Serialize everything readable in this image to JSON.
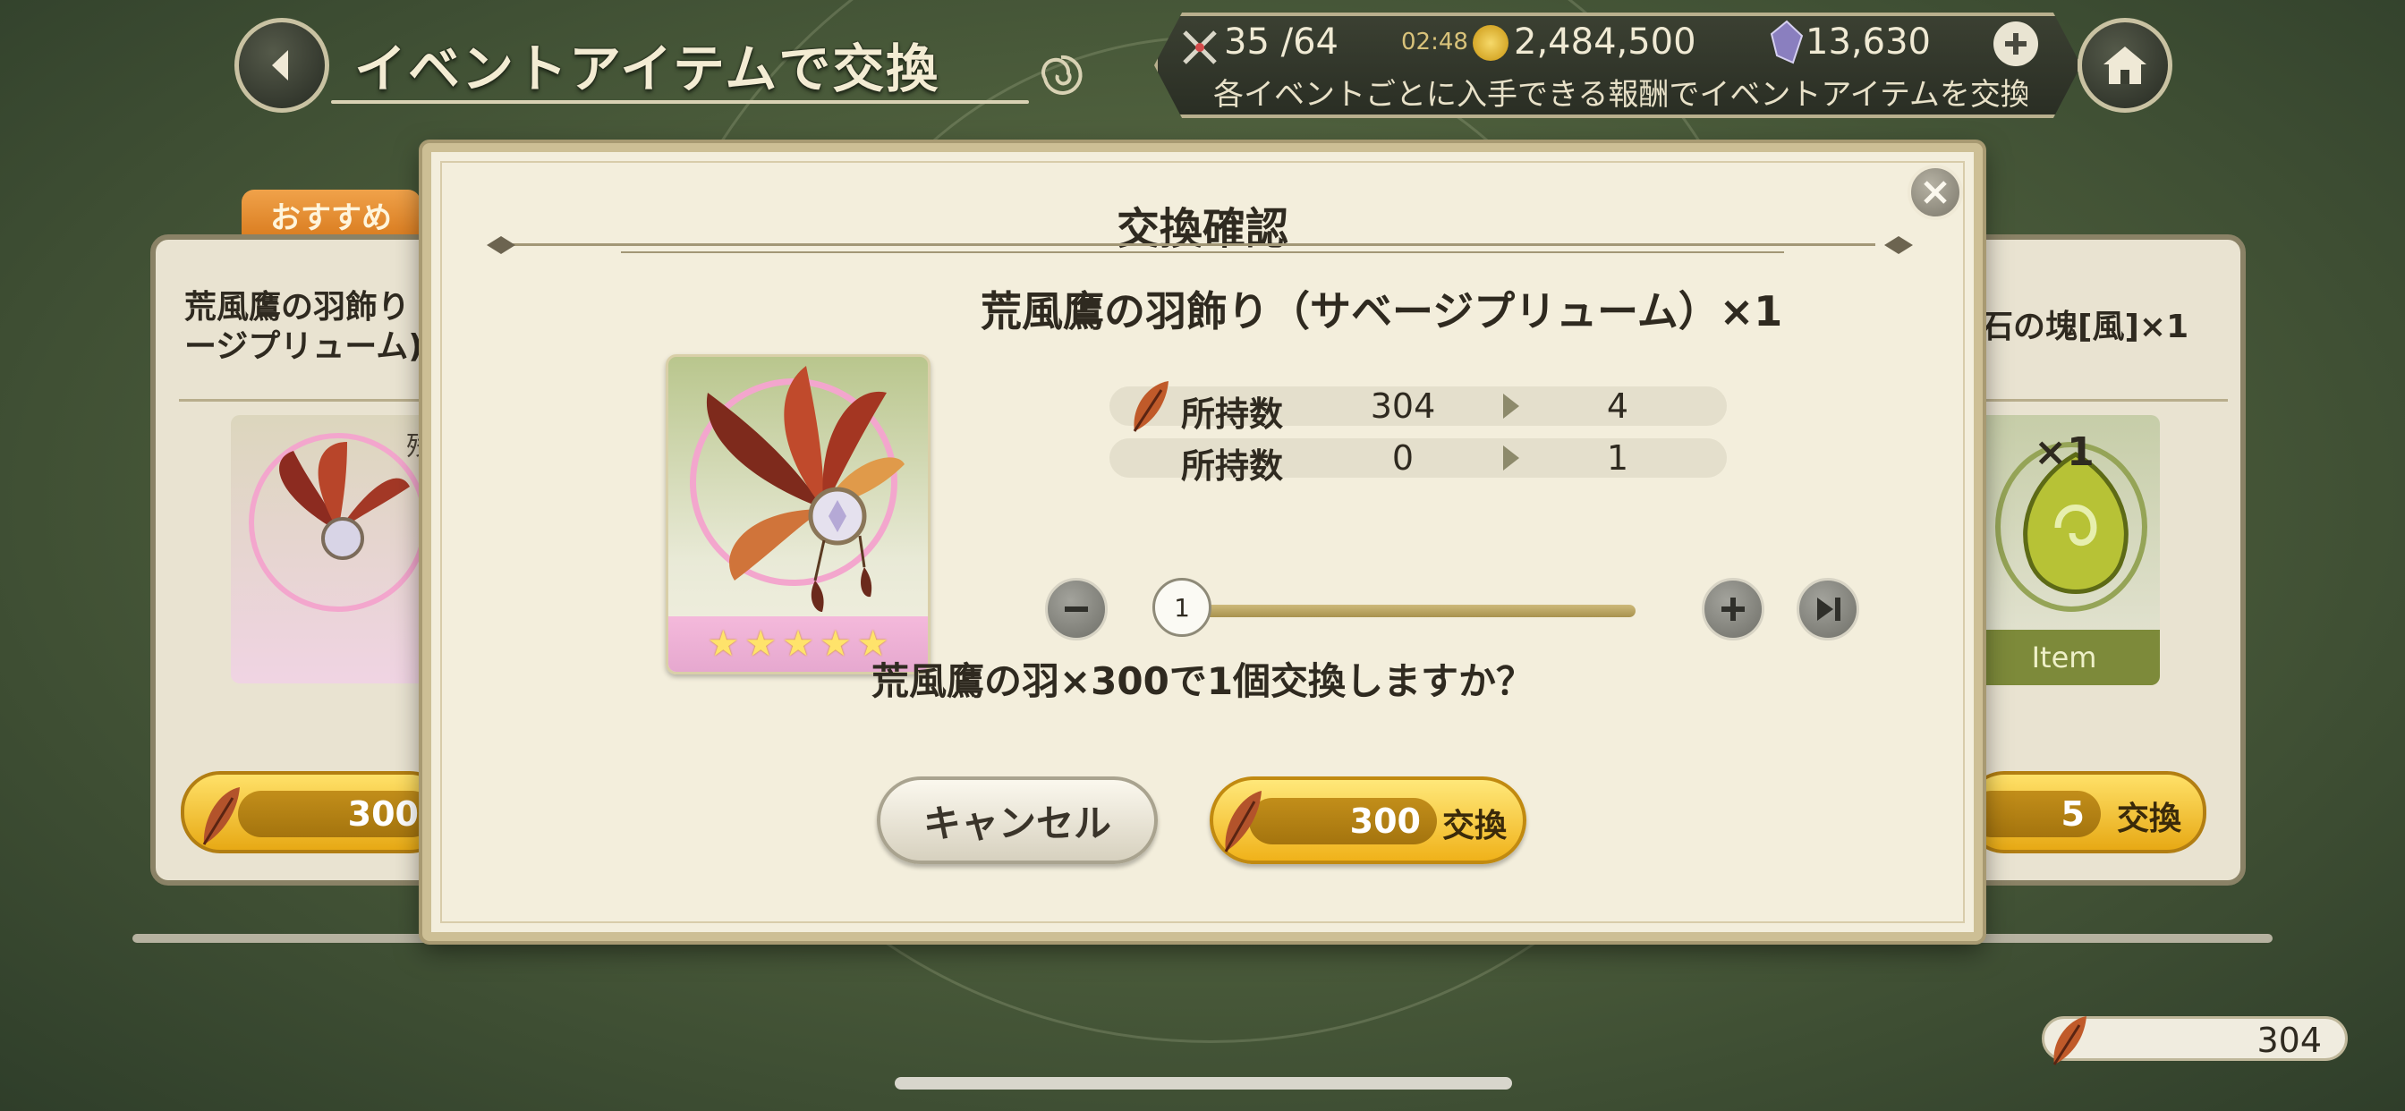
{
  "header": {
    "title": "イベントアイテムで交換",
    "stamina": "35 /64",
    "timer": "02:48",
    "gold": "2,484,500",
    "crystals": "13,630",
    "description": "各イベントごとに入手できる報酬でイベントアイテムを交換する"
  },
  "background_cards": {
    "recommend_tab": "おすすめ",
    "left_card_name": "荒風鷹の羽飾り\nージプリューム)",
    "left_card_price": "300",
    "left_card_badge": "残",
    "right_card_name": "石の塊[風]×1",
    "right_card_qty": "×1",
    "right_card_item_label": "Item",
    "right_card_price": "5",
    "right_card_exchange": "交換"
  },
  "dialog": {
    "title": "交換確認",
    "item_name": "荒風鷹の羽飾り（サベージプリューム）×1",
    "rows": [
      {
        "label": "所持数",
        "before": "304",
        "after": "4"
      },
      {
        "label": "所持数",
        "before": "0",
        "after": "1"
      }
    ],
    "slider_value": "1",
    "question": "荒風鷹の羽×300で1個交換しますか？",
    "cancel_label": "キャンセル",
    "exchange_price": "300",
    "exchange_label": "交換"
  },
  "footer": {
    "feather_count": "304"
  },
  "colors": {
    "gold_button": "#f0b21a",
    "dialog_bg": "#f3eedc",
    "recommend_tab": "#e38a2a"
  }
}
